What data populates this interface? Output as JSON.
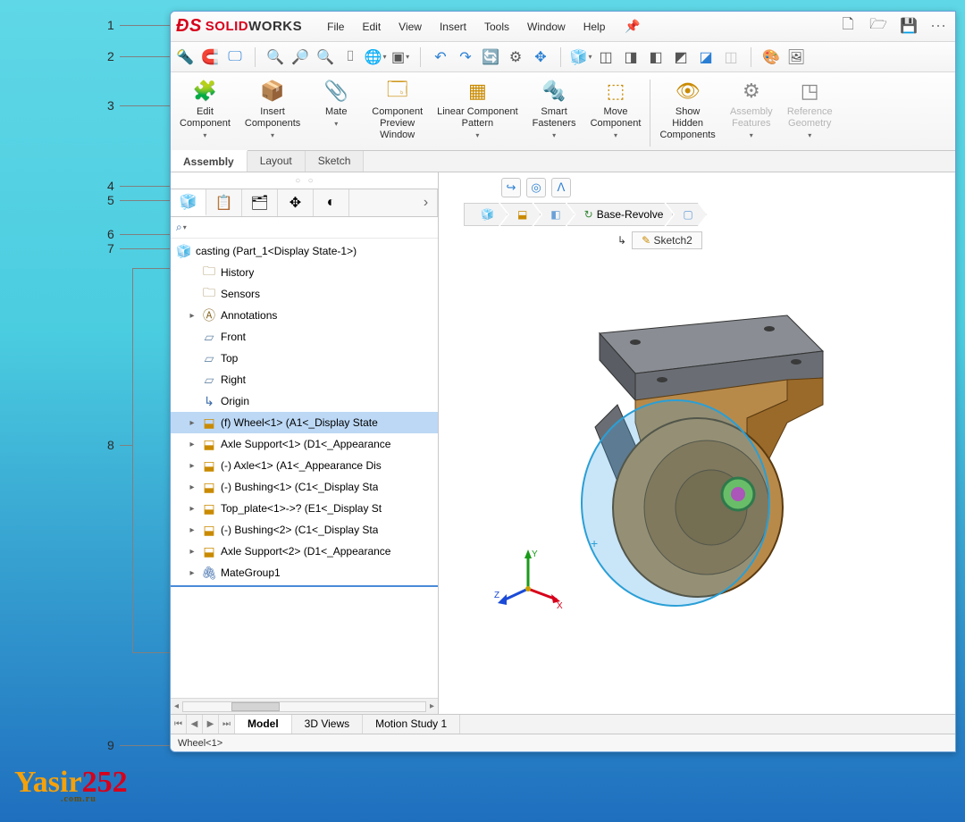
{
  "logo": {
    "brand1": "SOLID",
    "brand2": "WORKS"
  },
  "menu": [
    "File",
    "Edit",
    "View",
    "Insert",
    "Tools",
    "Window",
    "Help"
  ],
  "ribbon": [
    {
      "icon": "🧩",
      "color": "gold",
      "label": "Edit\nComponent",
      "caret": true
    },
    {
      "icon": "📦",
      "color": "gold",
      "label": "Insert\nComponents",
      "caret": true
    },
    {
      "icon": "📎",
      "color": "",
      "label": "Mate",
      "caret": true
    },
    {
      "icon": "🗔",
      "color": "gold",
      "label": "Component\nPreview\nWindow"
    },
    {
      "icon": "▦",
      "color": "gold",
      "label": "Linear Component\nPattern",
      "caret": true
    },
    {
      "icon": "🔩",
      "color": "gold",
      "label": "Smart\nFasteners",
      "caret": true
    },
    {
      "icon": "⬚",
      "color": "gold",
      "label": "Move\nComponent",
      "caret": true
    },
    {
      "sep": true
    },
    {
      "icon": "👁",
      "color": "gold",
      "label": "Show\nHidden\nComponents"
    },
    {
      "icon": "⚙",
      "color": "",
      "label": "Assembly\nFeatures",
      "dim": true,
      "caret": true
    },
    {
      "icon": "◳",
      "color": "",
      "label": "Reference\nGeometry",
      "dim": true,
      "caret": true
    }
  ],
  "cm_tabs": [
    "Assembly",
    "Layout",
    "Sketch"
  ],
  "cm_active": 0,
  "panel_tabs_icons": [
    "🧊",
    "📋",
    "🗂",
    "✥",
    "◐"
  ],
  "tree": {
    "root": "casting  (Part_1<Display State-1>)",
    "items": [
      {
        "tw": "",
        "icon": "🗀",
        "cls": "folder",
        "label": "History"
      },
      {
        "tw": "",
        "icon": "🗀",
        "cls": "folder",
        "label": "Sensors"
      },
      {
        "tw": "▸",
        "icon": "Ⓐ",
        "cls": "folder",
        "label": "Annotations"
      },
      {
        "tw": "",
        "icon": "▱",
        "cls": "plane",
        "label": "Front"
      },
      {
        "tw": "",
        "icon": "▱",
        "cls": "plane",
        "label": "Top"
      },
      {
        "tw": "",
        "icon": "▱",
        "cls": "plane",
        "label": "Right"
      },
      {
        "tw": "",
        "icon": "↳",
        "cls": "blue",
        "label": "Origin"
      },
      {
        "tw": "▸",
        "icon": "⬓",
        "cls": "gold",
        "label": "(f) Wheel<1> (A1<<A1>_Display State",
        "sel": true
      },
      {
        "tw": "▸",
        "icon": "⬓",
        "cls": "gold",
        "label": "Axle Support<1> (D1<<D1>_Appearance"
      },
      {
        "tw": "▸",
        "icon": "⬓",
        "cls": "gold",
        "label": "(-) Axle<1> (A1<<A1>_Appearance Dis"
      },
      {
        "tw": "▸",
        "icon": "⬓",
        "cls": "gold",
        "label": "(-) Bushing<1> (C1<<C1>_Display Sta"
      },
      {
        "tw": "▸",
        "icon": "⬓",
        "cls": "gold",
        "label": "Top_plate<1>->? (E1<<E1>_Display St"
      },
      {
        "tw": "▸",
        "icon": "⬓",
        "cls": "gold",
        "label": "(-) Bushing<2> (C1<<C1>_Display Sta"
      },
      {
        "tw": "▸",
        "icon": "⬓",
        "cls": "gold",
        "label": "Axle Support<2> (D1<<D1>_Appearance"
      },
      {
        "tw": "▸",
        "icon": "🖇",
        "cls": "blue",
        "label": "MateGroup1"
      }
    ]
  },
  "breadcrumb_feature": "Base-Revolve",
  "sub_breadcrumb": "Sketch2",
  "bottom_tabs": [
    "Model",
    "3D Views",
    "Motion Study 1"
  ],
  "bottom_active": 0,
  "status": "Wheel<1>",
  "callouts": {
    "1": "1",
    "2": "2",
    "3": "3",
    "4": "4",
    "5": "5",
    "6": "6",
    "7": "7",
    "8": "8",
    "9": "9"
  },
  "triad_labels": {
    "x": "X",
    "y": "Y",
    "z": "Z"
  },
  "watermark": {
    "y": "Yasir",
    "num": "252",
    "sub": ".com.ru"
  }
}
